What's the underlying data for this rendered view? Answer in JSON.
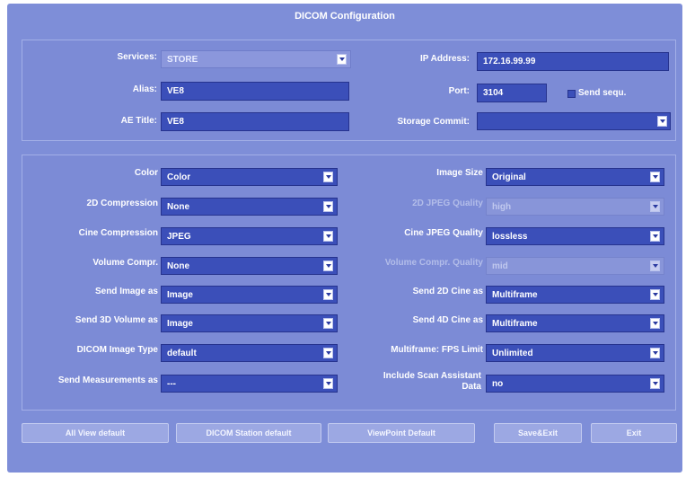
{
  "title": "DICOM Configuration",
  "top": {
    "services_label": "Services:",
    "services_value": "STORE",
    "alias_label": "Alias:",
    "alias_value": "VE8",
    "ae_title_label": "AE Title:",
    "ae_title_value": "VE8",
    "ip_label": "IP Address:",
    "ip_value": "172.16.99.99",
    "port_label": "Port:",
    "port_value": "3104",
    "send_sequ_label": "Send sequ.",
    "storage_commit_label": "Storage Commit:",
    "storage_commit_value": ""
  },
  "left": [
    {
      "label": "Color",
      "value": "Color"
    },
    {
      "label": "2D Compression",
      "value": "None"
    },
    {
      "label": "Cine Compression",
      "value": "JPEG"
    },
    {
      "label": "Volume Compr.",
      "value": "None"
    },
    {
      "label": "Send Image as",
      "value": "Image"
    },
    {
      "label": "Send 3D Volume as",
      "value": "Image"
    },
    {
      "label": "DICOM Image Type",
      "value": "default"
    },
    {
      "label": "Send Measurements as",
      "value": "---"
    }
  ],
  "right": [
    {
      "label": "Image Size",
      "value": "Original"
    },
    {
      "label": "2D JPEG Quality",
      "value": "high"
    },
    {
      "label": "Cine JPEG Quality",
      "value": "lossless"
    },
    {
      "label": "Volume Compr. Quality",
      "value": "mid"
    },
    {
      "label": "Send 2D Cine as",
      "value": "Multiframe"
    },
    {
      "label": "Send 4D Cine as",
      "value": "Multiframe"
    },
    {
      "label": "Multiframe: FPS Limit",
      "value": "Unlimited"
    },
    {
      "label": "Include Scan Assistant Data",
      "value": "no"
    }
  ],
  "buttons": {
    "all_view_default": "All View default",
    "dicom_station_default": "DICOM Station default",
    "viewpoint_default": "ViewPoint Default",
    "save_exit": "Save&Exit",
    "exit": "Exit"
  }
}
